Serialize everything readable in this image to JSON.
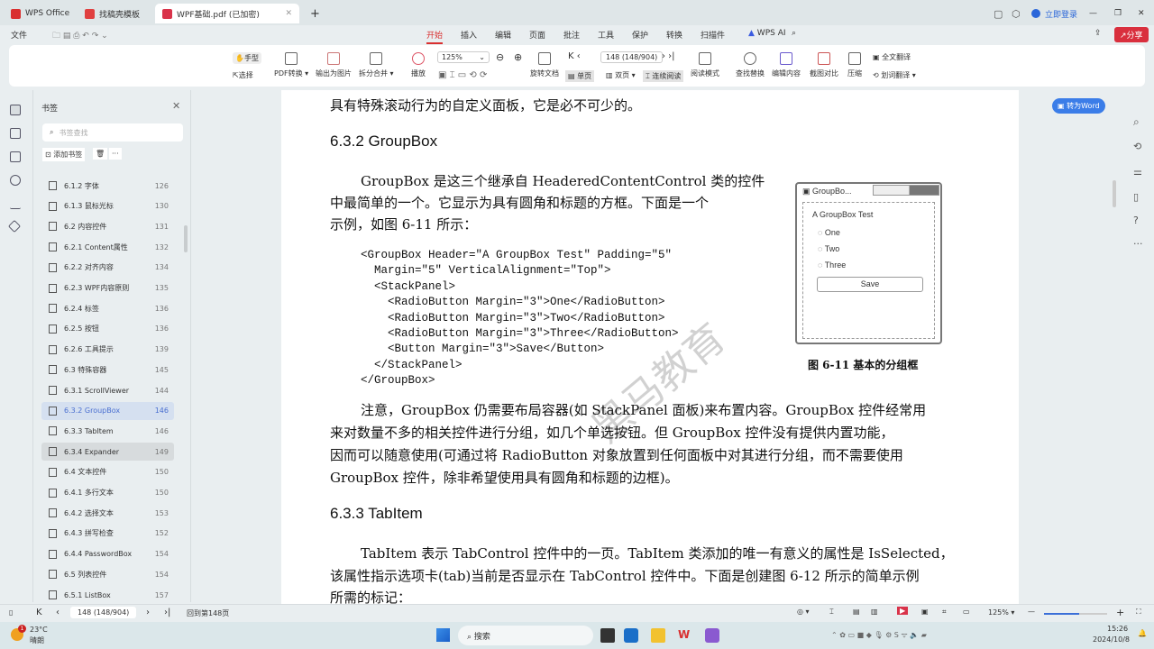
{
  "tabs": [
    {
      "label": "WPS Office",
      "color": "#d92f2f"
    },
    {
      "label": "找稿壳模板",
      "color": "#e04040"
    },
    {
      "label": "WPF基础.pdf (已加密)",
      "color": "#d9334a"
    }
  ],
  "window": {
    "login": "立即登录",
    "share": "分享"
  },
  "menu": {
    "file": "文件",
    "items": [
      "开始",
      "插入",
      "编辑",
      "页面",
      "批注",
      "工具",
      "保护",
      "转换",
      "扫描件"
    ],
    "ai": "WPS AI"
  },
  "ribbon": {
    "hand": "手型",
    "select": "选择",
    "pdf_convert": "PDF转换",
    "export_image": "输出为图片",
    "split_merge": "拆分合并",
    "play": "播放",
    "zoom": "125%",
    "page_input": "148 (148/904)",
    "rotate": "旋转文档",
    "single": "单页",
    "double": "双页",
    "continuous": "连续阅读",
    "read_mode": "阅读模式",
    "find_replace": "查找替换",
    "edit_content": "编辑内容",
    "screenshot_compare": "截图对比",
    "compress": "压缩",
    "full_translate": "全文翻译",
    "word_translate": "划词翻译"
  },
  "bookmarks": {
    "title": "书签",
    "search_placeholder": "书签查找",
    "add": "添加书签",
    "items": [
      {
        "label": "6.1.2 字体",
        "page": "126"
      },
      {
        "label": "6.1.3 鼠标光标",
        "page": "130"
      },
      {
        "label": "6.2 内容控件",
        "page": "131"
      },
      {
        "label": "6.2.1 Content属性",
        "page": "132"
      },
      {
        "label": "6.2.2 对齐内容",
        "page": "134"
      },
      {
        "label": "6.2.3 WPF内容原则",
        "page": "135"
      },
      {
        "label": "6.2.4 标签",
        "page": "136"
      },
      {
        "label": "6.2.5 按钮",
        "page": "136"
      },
      {
        "label": "6.2.6 工具提示",
        "page": "139"
      },
      {
        "label": "6.3 特殊容器",
        "page": "145"
      },
      {
        "label": "6.3.1 ScrollViewer",
        "page": "144"
      },
      {
        "label": "6.3.2 GroupBox",
        "page": "146"
      },
      {
        "label": "6.3.3 TabItem",
        "page": "146"
      },
      {
        "label": "6.3.4 Expander",
        "page": "149"
      },
      {
        "label": "6.4 文本控件",
        "page": "150"
      },
      {
        "label": "6.4.1 多行文本",
        "page": "150"
      },
      {
        "label": "6.4.2 选择文本",
        "page": "153"
      },
      {
        "label": "6.4.3 拼写检查",
        "page": "152"
      },
      {
        "label": "6.4.4 PasswordBox",
        "page": "154"
      },
      {
        "label": "6.5 列表控件",
        "page": "154"
      },
      {
        "label": "6.5.1 ListBox",
        "page": "157"
      }
    ]
  },
  "doc": {
    "line0": "具有特殊滚动行为的自定义面板，它是必不可少的。",
    "h1": "6.3.2   GroupBox",
    "p1": [
      "GroupBox 是这三个继承自 HeaderedContentControl 类的控件",
      "中最简单的一个。它显示为具有圆角和标题的方框。下面是一个",
      "示例，如图 6-11 所示："
    ],
    "code": [
      "<GroupBox Header=\"A GroupBox Test\" Padding=\"5\"",
      "  Margin=\"5\" VerticalAlignment=\"Top\">",
      "  <StackPanel>",
      "    <RadioButton Margin=\"3\">One</RadioButton>",
      "    <RadioButton Margin=\"3\">Two</RadioButton>",
      "    <RadioButton Margin=\"3\">Three</RadioButton>",
      "    <Button Margin=\"3\">Save</Button>",
      "  </StackPanel>",
      "</GroupBox>"
    ],
    "p2": [
      "注意，GroupBox 仍需要布局容器(如 StackPanel 面板)来布置内容。GroupBox 控件经常用",
      "来对数量不多的相关控件进行分组，如几个单选按钮。但 GroupBox 控件没有提供内置功能，",
      "因而可以随意使用(可通过将 RadioButton 对象放置到任何面板中对其进行分组，而不需要使用",
      "GroupBox 控件，除非希望使用具有圆角和标题的边框)。"
    ],
    "h2": "6.3.3   TabItem",
    "p3": [
      "TabItem 表示 TabControl 控件中的一页。TabItem 类添加的唯一有意义的属性是 IsSelected，",
      "该属性指示选项卡(tab)当前是否显示在 TabControl 控件中。下面是创建图 6-12 所示的简单示例",
      "所需的标记："
    ],
    "figure": {
      "window_title": "GroupBo...",
      "header": "A GroupBox Test",
      "radios": [
        "One",
        "Two",
        "Three"
      ],
      "button": "Save",
      "caption": "图 6-11    基本的分组框"
    },
    "watermark": "黑马教育"
  },
  "to_word": "转为Word",
  "status": {
    "page": "148 (148/904)",
    "back": "回到第148页",
    "zoom": "125%",
    "zoom_fraction": 0.55
  },
  "taskbar": {
    "temp": "23°C",
    "weather": "晴朗",
    "badge": "1",
    "search": "搜索",
    "time": "15:26",
    "date": "2024/10/8"
  }
}
